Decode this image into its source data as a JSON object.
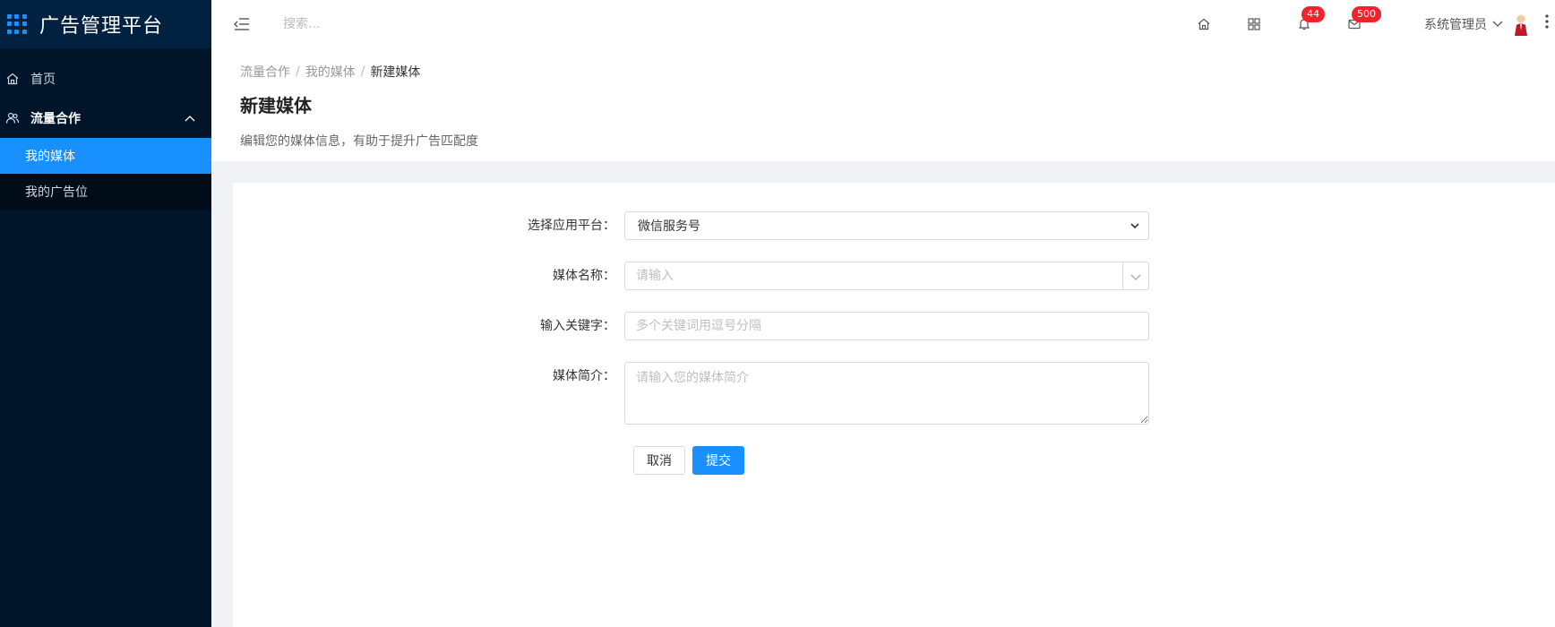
{
  "app": {
    "title": "广告管理平台"
  },
  "sidebar": {
    "items": [
      {
        "label": "首页",
        "icon": "home-icon"
      },
      {
        "label": "流量合作",
        "icon": "users-icon",
        "expanded": true,
        "children": [
          {
            "label": "我的媒体",
            "active": true
          },
          {
            "label": "我的广告位",
            "active": false
          }
        ]
      }
    ]
  },
  "header": {
    "search_placeholder": "搜索...",
    "notifications_count": "44",
    "messages_count": "500",
    "user_name": "系统管理员"
  },
  "breadcrumb": {
    "items": [
      "流量合作",
      "我的媒体"
    ],
    "current": "新建媒体",
    "separator": "/"
  },
  "page": {
    "title": "新建媒体",
    "description": "编辑您的媒体信息，有助于提升广告匹配度"
  },
  "form": {
    "platform_label": "选择应用平台：",
    "platform_value": "微信服务号",
    "name_label": "媒体名称：",
    "name_placeholder": "请输入",
    "keywords_label": "输入关键字：",
    "keywords_placeholder": "多个关键词用逗号分隔",
    "intro_label": "媒体简介：",
    "intro_placeholder": "请输入您的媒体简介",
    "cancel_label": "取消",
    "submit_label": "提交"
  },
  "colors": {
    "sidebar_bg": "#001529",
    "accent": "#1890ff",
    "badge": "#f5222d"
  }
}
